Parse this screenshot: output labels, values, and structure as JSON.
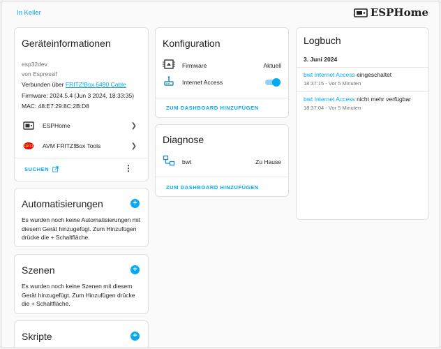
{
  "header": {
    "breadcrumb": "In Keller",
    "brand": "ESPHome"
  },
  "device_info": {
    "title": "Geräteinformationen",
    "model": "esp32dev",
    "manufacturer": "von Espressif",
    "connected_prefix": "Verbunden über ",
    "connected_link": "FRITZ!Box 6490 Cable",
    "firmware": "Firmware: 2024.5.4 (Jun 3 2024, 18:33:35)",
    "mac": "MAC: 48:E7:29:8C:2B:D8",
    "integrations": [
      {
        "label": "ESPHome",
        "icon": "esphome-icon"
      },
      {
        "label": "AVM FRITZ!Box Tools",
        "icon": "fritz-icon"
      }
    ],
    "search_label": "SUCHEN",
    "menu_icon": "more-vert-icon"
  },
  "automations": {
    "title": "Automatisierungen",
    "text": "Es wurden noch keine Automatisierungen mit diesem Gerät hinzugefügt. Zum Hinzufügen drücke die + Schaltfläche."
  },
  "scenes": {
    "title": "Szenen",
    "text": "Es wurden noch keine Szenen mit diesem Gerät hinzugefügt. Zum Hinzufügen drücke die + Schaltfläche."
  },
  "scripts": {
    "title": "Skripte"
  },
  "configuration": {
    "title": "Konfiguration",
    "entities": [
      {
        "name": "Firmware",
        "state": "Aktuell",
        "icon": "chip-icon"
      },
      {
        "name": "Internet Access",
        "state": "on",
        "icon": "router-icon"
      }
    ],
    "add_label": "ZUM DASHBOARD HINZUFÜGEN"
  },
  "diagnostics": {
    "title": "Diagnose",
    "entities": [
      {
        "name": "bwt",
        "state": "Zu Hause",
        "icon": "lan-icon"
      }
    ],
    "add_label": "ZUM DASHBOARD HINZUFÜGEN"
  },
  "logbook": {
    "title": "Logbuch",
    "date": "3. Juni 2024",
    "entries": [
      {
        "entity": "bwt Internet Access",
        "message": " eingeschaltet",
        "time": "18:37:15 - Vor 5 Minuten"
      },
      {
        "entity": "bwt Internet Access",
        "message": " nicht mehr verfügbar",
        "time": "18:37:04 - Vor 5 Minuten"
      }
    ]
  },
  "colors": {
    "accent": "#03a9f4",
    "background": "#fafafa",
    "card": "#ffffff",
    "text": "#212121",
    "secondary": "#727272"
  }
}
